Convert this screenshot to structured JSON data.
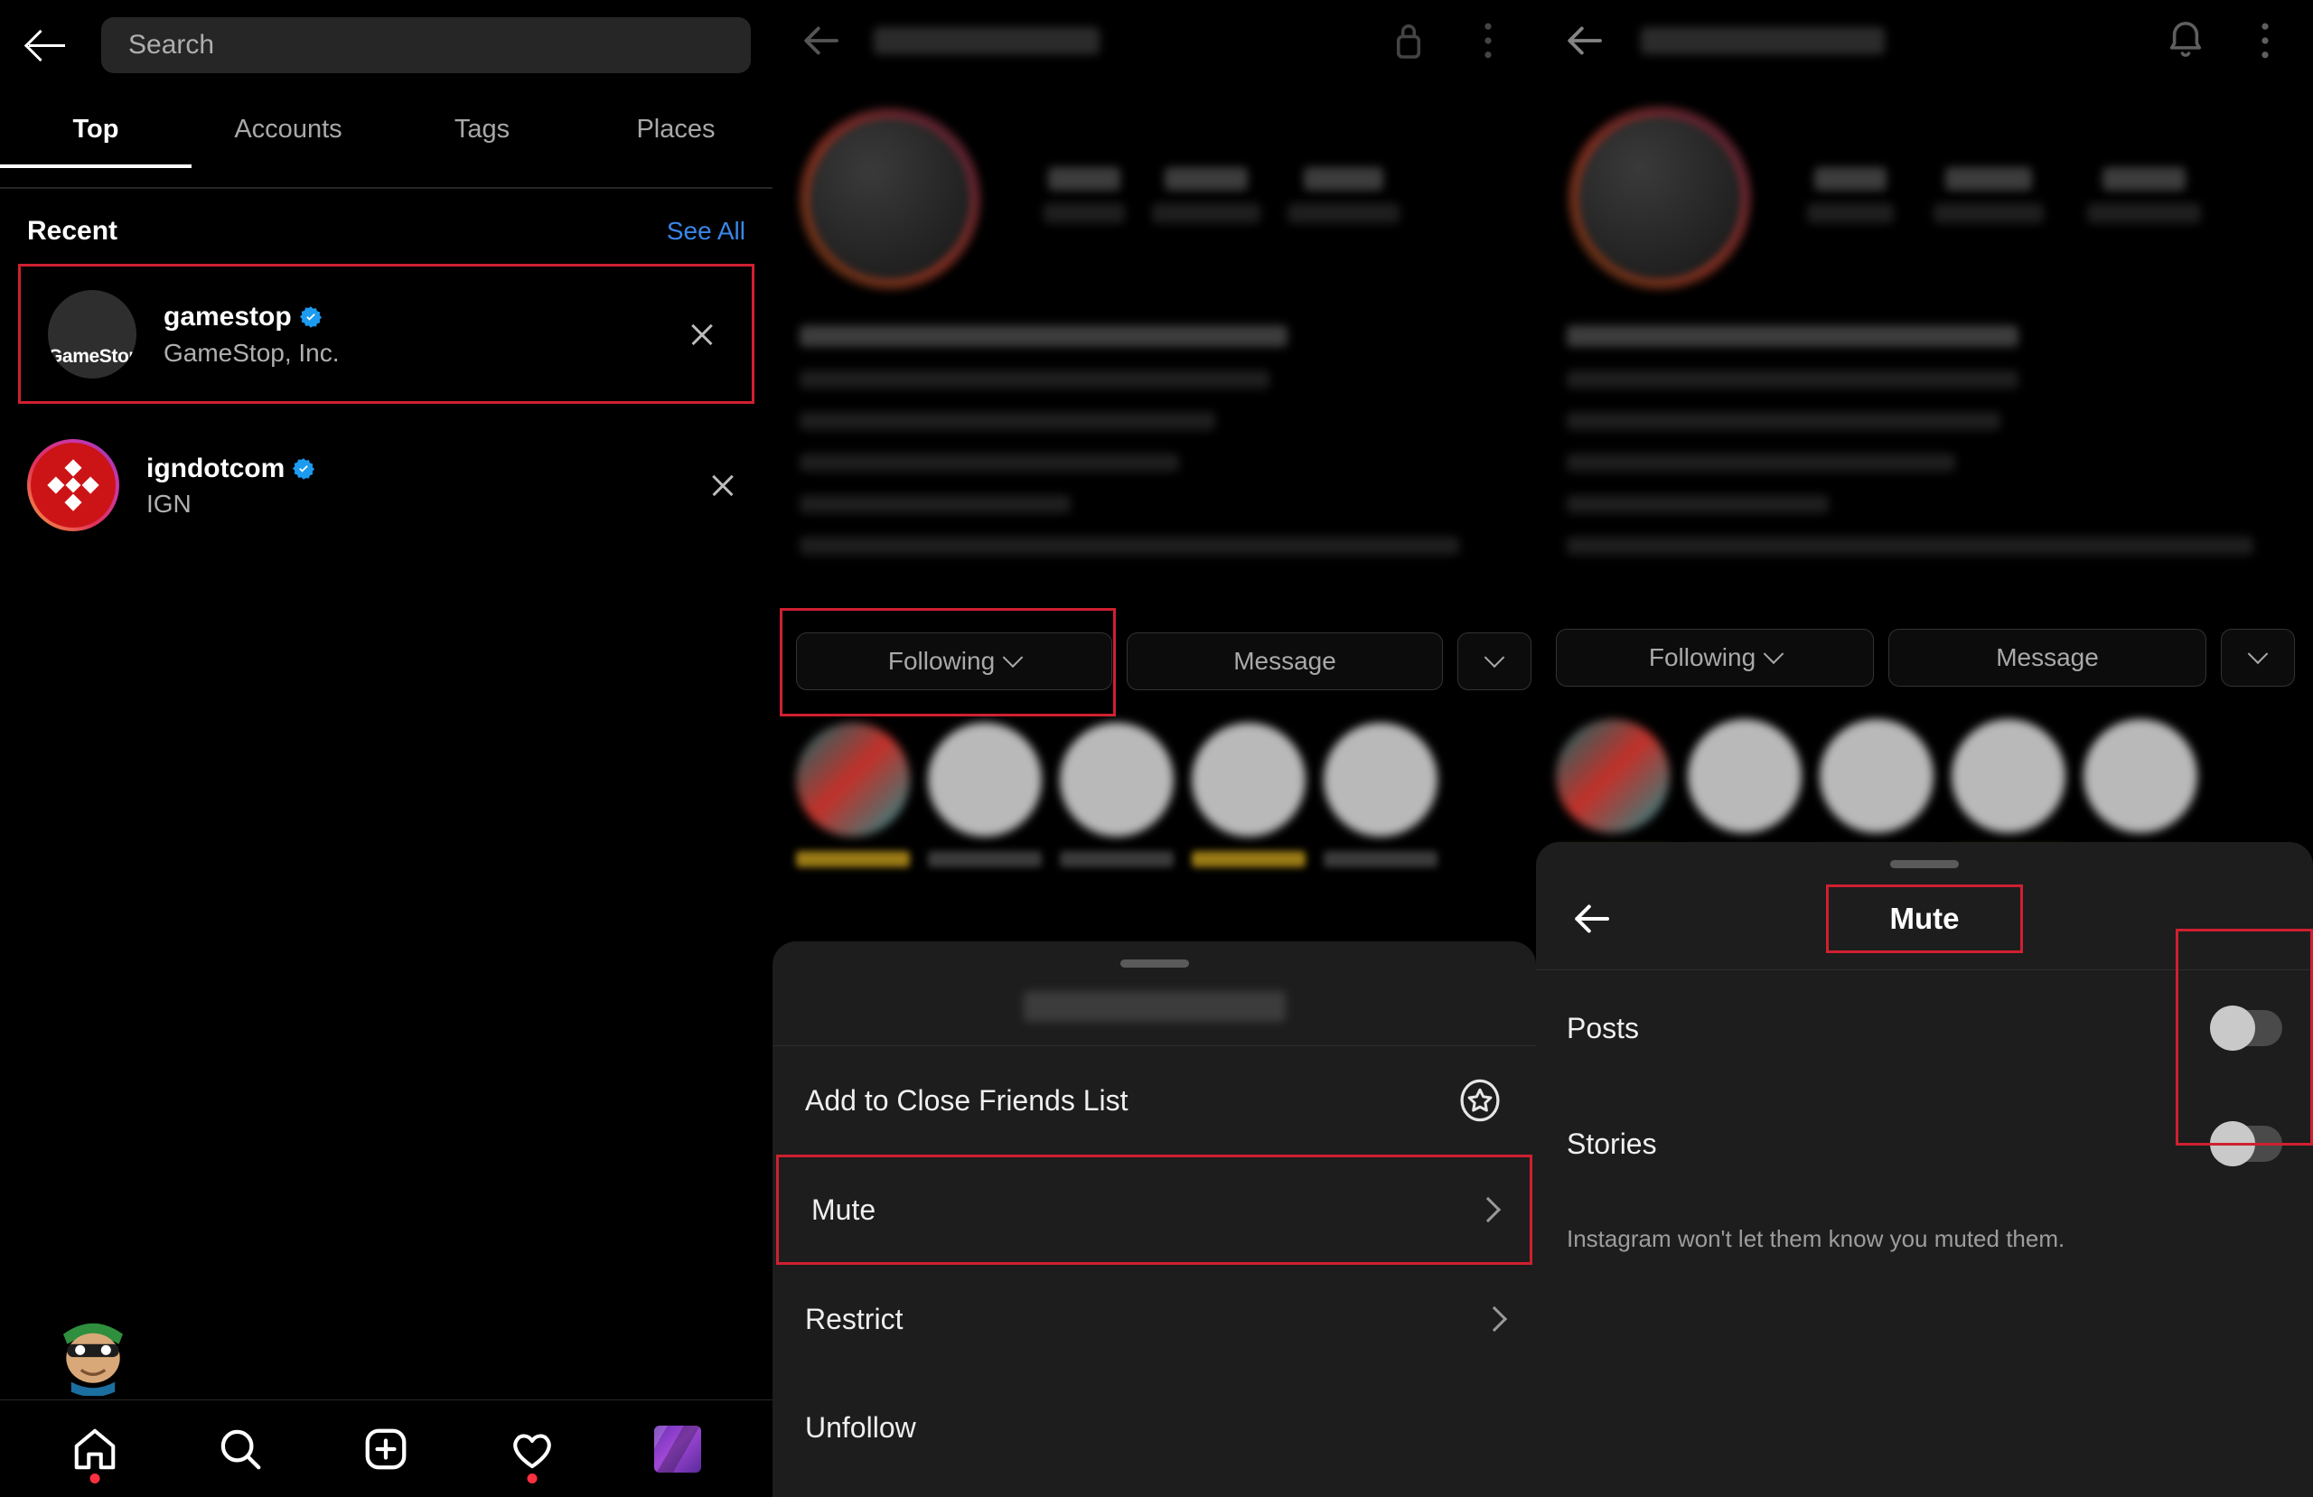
{
  "app": {
    "name": "Instagram",
    "theme": "dark",
    "accent_red": "#cf2030",
    "link_blue": "#3a86e8",
    "verified_blue": "#1d9bf0"
  },
  "search_panel": {
    "back_icon": "back-arrow-icon",
    "search": {
      "placeholder": "Search",
      "value": ""
    },
    "tabs": [
      {
        "label": "Top",
        "active": true
      },
      {
        "label": "Accounts",
        "active": false
      },
      {
        "label": "Tags",
        "active": false
      },
      {
        "label": "Places",
        "active": false
      }
    ],
    "recent": {
      "title": "Recent",
      "see_all": "See All",
      "items": [
        {
          "username": "gamestop",
          "fullname": "GameStop, Inc.",
          "verified": true,
          "avatar_text": "GameStop",
          "highlighted": true,
          "remove_icon": "close-icon"
        },
        {
          "username": "igndotcom",
          "fullname": "IGN",
          "verified": true,
          "avatar_text": "",
          "highlighted": false,
          "remove_icon": "close-icon"
        }
      ]
    },
    "bottom_nav": [
      {
        "icon": "home-icon",
        "active": true,
        "badge": true
      },
      {
        "icon": "search-icon",
        "active": false,
        "badge": false
      },
      {
        "icon": "add-post-icon",
        "active": false,
        "badge": false
      },
      {
        "icon": "heart-icon",
        "active": false,
        "badge": true
      },
      {
        "icon": "profile-avatar-icon",
        "active": false,
        "badge": false
      }
    ]
  },
  "profile_panel": {
    "topbar": {
      "back_icon": "back-arrow-icon",
      "lock_icon": "lock-icon",
      "menu_icon": "more-options-icon"
    },
    "actions": {
      "following_label": "Following",
      "following_chevron": "chevron-down-icon",
      "message_label": "Message",
      "more_chevron": "chevron-down-icon"
    },
    "sheet": {
      "grabber": "drag-handle",
      "items": [
        {
          "label": "Add to Close Friends List",
          "trailing": "star-outline-icon",
          "highlighted": false
        },
        {
          "label": "Mute",
          "trailing": "chevron-right-icon",
          "highlighted": true
        },
        {
          "label": "Restrict",
          "trailing": "chevron-right-icon",
          "highlighted": false
        },
        {
          "label": "Unfollow",
          "trailing": "",
          "highlighted": false
        }
      ]
    }
  },
  "mute_panel": {
    "topbar": {
      "back_icon": "back-arrow-icon",
      "bell_icon": "notification-bell-icon",
      "menu_icon": "more-options-icon"
    },
    "actions": {
      "following_label": "Following",
      "following_chevron": "chevron-down-icon",
      "message_label": "Message",
      "more_chevron": "chevron-down-icon"
    },
    "sheet": {
      "grabber": "drag-handle",
      "back_icon": "back-arrow-icon",
      "title": "Mute",
      "rows": [
        {
          "label": "Posts",
          "toggle_on": false
        },
        {
          "label": "Stories",
          "toggle_on": false
        }
      ],
      "note": "Instagram won't let them know you muted them."
    }
  }
}
